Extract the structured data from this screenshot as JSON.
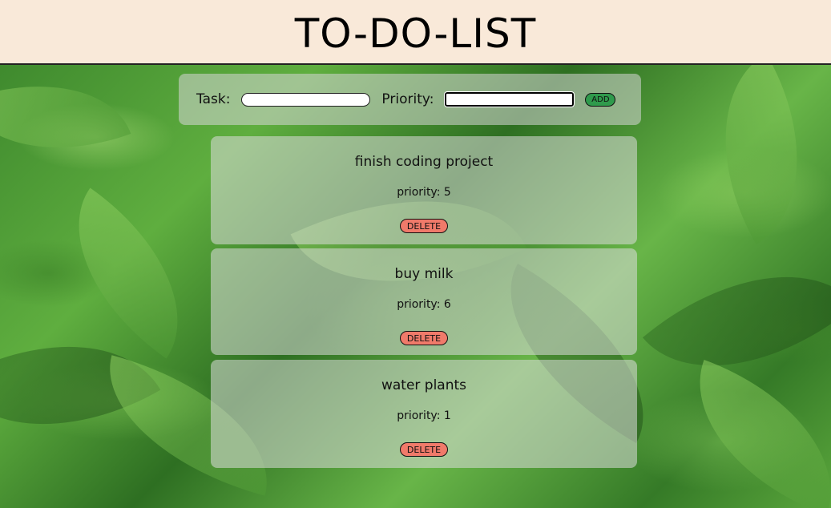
{
  "header": {
    "title": "TO-DO-LIST"
  },
  "form": {
    "task_label": "Task:",
    "task_value": "",
    "priority_label": "Priority:",
    "priority_value": "",
    "add_label": "ADD"
  },
  "tasks": [
    {
      "title": "finish coding project",
      "priority_text": "priority: 5",
      "delete_label": "DELETE"
    },
    {
      "title": "buy milk",
      "priority_text": "priority: 6",
      "delete_label": "DELETE"
    },
    {
      "title": "water plants",
      "priority_text": "priority: 1",
      "delete_label": "DELETE"
    }
  ],
  "colors": {
    "header_bg": "#f9e9d9",
    "add_button": "#2f9a4c",
    "delete_button": "#f07a6a"
  }
}
